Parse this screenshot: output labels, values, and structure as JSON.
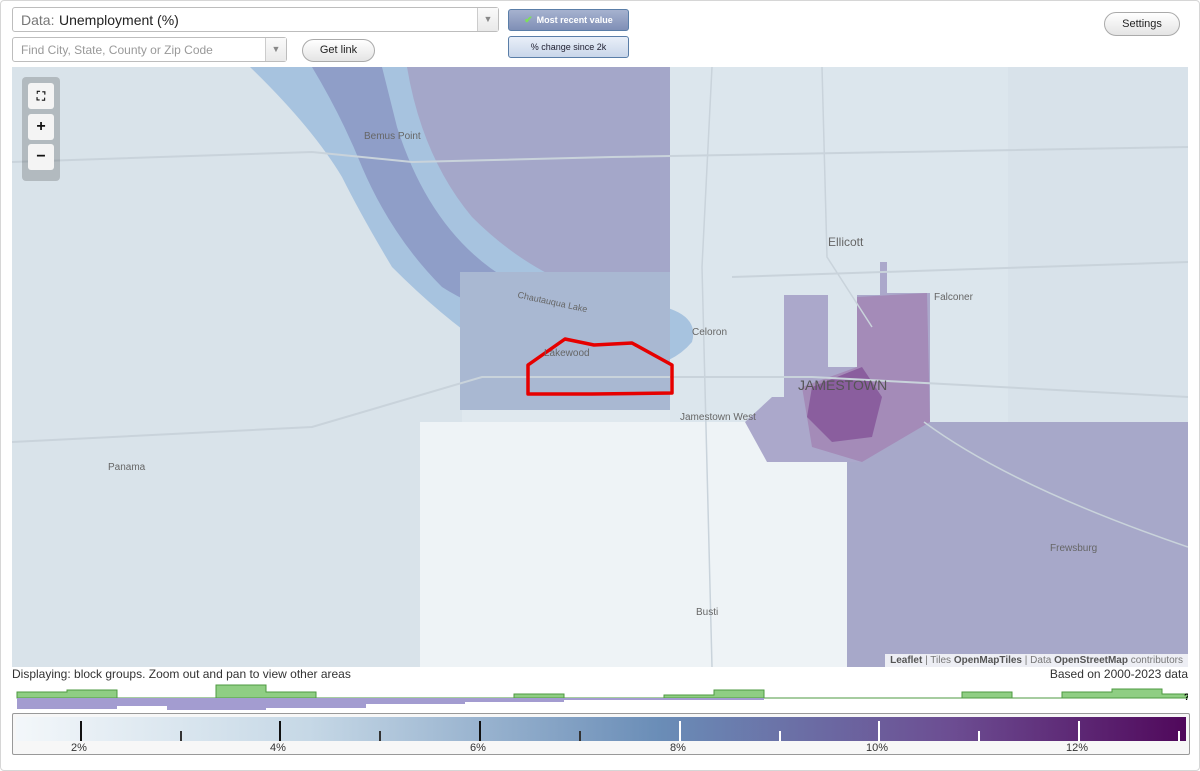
{
  "controls": {
    "data_label": "Data:",
    "data_value": "Unemployment (%)",
    "search_placeholder": "Find City, State, County or Zip Code",
    "get_link": "Get link",
    "settings": "Settings",
    "toggle_active": "Most recent value",
    "toggle_inactive": "% change since 2k"
  },
  "map": {
    "zoom_in": "+",
    "zoom_out": "−",
    "places": {
      "bemus_point": "Bemus Point",
      "chautauqua_lake": "Chautauqua Lake",
      "ellicott": "Ellicott",
      "celoron": "Celoron",
      "lakewood": "Lakewood",
      "falconer": "Falconer",
      "jamestown": "JAMESTOWN",
      "jamestown_west": "Jamestown West",
      "panama": "Panama",
      "frewsburg": "Frewsburg",
      "busti": "Busti"
    },
    "attribution": {
      "leaflet": "Leaflet",
      "sep1": " | Tiles ",
      "tiles": "OpenMapTiles",
      "sep2": " | Data ",
      "data": "OpenStreetMap",
      "contributors": " contributors"
    },
    "highlight_color": "#e60000"
  },
  "footer": {
    "displaying": "Displaying: block groups. Zoom out and pan to view other areas",
    "based_on": "Based on 2000-2023 data",
    "help": "?"
  },
  "legend": {
    "labels": [
      "2%",
      "4%",
      "6%",
      "8%",
      "10%",
      "12%"
    ],
    "min_color": "#f3f7fa",
    "max_color": "#50085b"
  }
}
